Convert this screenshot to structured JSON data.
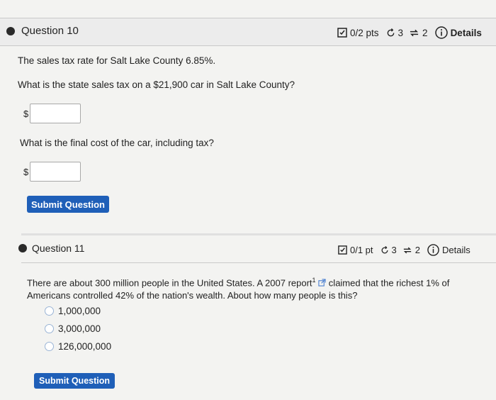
{
  "q10": {
    "title": "Question 10",
    "points": "0/2 pts",
    "attempts": "3",
    "retries": "2",
    "details": "Details",
    "prompt": "The sales tax rate for Salt Lake County 6.85%.",
    "part1": "What is the state sales tax on a $21,900 car in Salt Lake County?",
    "part2": "What is the final cost of the car, including tax?",
    "currency": "$",
    "submit": "Submit Question"
  },
  "q11": {
    "title": "Question 11",
    "points": "0/1 pt",
    "attempts": "3",
    "retries": "2",
    "details": "Details",
    "text_a": "There are about 300 million people in the United States. A 2007 report",
    "sup": "1",
    "text_b": " claimed that the richest 1% of",
    "text_c": "Americans controlled 42% of the nation's wealth. About how many people is this?",
    "options": [
      "1,000,000",
      "3,000,000",
      "126,000,000"
    ],
    "submit": "Submit Question"
  }
}
